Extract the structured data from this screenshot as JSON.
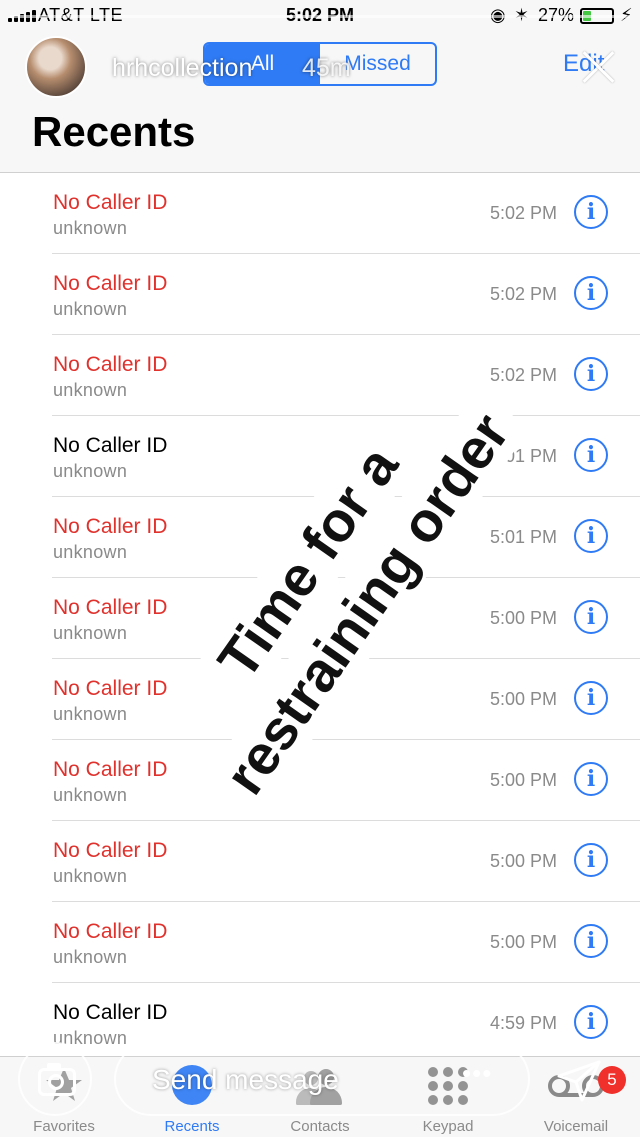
{
  "status_bar": {
    "carrier": "AT&T  LTE",
    "time": "5:02 PM",
    "battery_percent": "27%",
    "battery_level": 0.27,
    "icons": [
      "signal-bars-icon",
      "location-icon",
      "bluetooth-icon",
      "battery-icon",
      "charging-icon"
    ]
  },
  "header": {
    "segments": [
      "All",
      "Missed"
    ],
    "selected_segment": "All",
    "edit_label": "Edit",
    "title": "Recents"
  },
  "story": {
    "username": "hrhcollection",
    "age": "45m",
    "sticker_text": [
      "Time for a",
      "restraining order"
    ],
    "message_placeholder": "Send message",
    "more_glyph": "•••"
  },
  "calls": [
    {
      "name": "No Caller ID",
      "detail": "unknown",
      "time": "5:02 PM",
      "missed": true
    },
    {
      "name": "No Caller ID",
      "detail": "unknown",
      "time": "5:02 PM",
      "missed": true
    },
    {
      "name": "No Caller ID",
      "detail": "unknown",
      "time": "5:02 PM",
      "missed": true
    },
    {
      "name": "No Caller ID",
      "detail": "unknown",
      "time": "5:01 PM",
      "missed": false
    },
    {
      "name": "No Caller ID",
      "detail": "unknown",
      "time": "5:01 PM",
      "missed": true
    },
    {
      "name": "No Caller ID",
      "detail": "unknown",
      "time": "5:00 PM",
      "missed": true
    },
    {
      "name": "No Caller ID",
      "detail": "unknown",
      "time": "5:00 PM",
      "missed": true
    },
    {
      "name": "No Caller ID",
      "detail": "unknown",
      "time": "5:00 PM",
      "missed": true
    },
    {
      "name": "No Caller ID",
      "detail": "unknown",
      "time": "5:00 PM",
      "missed": true
    },
    {
      "name": "No Caller ID",
      "detail": "unknown",
      "time": "5:00 PM",
      "missed": true
    },
    {
      "name": "No Caller ID",
      "detail": "unknown",
      "time": "4:59 PM",
      "missed": false
    }
  ],
  "info_glyph": "i",
  "tab_bar": {
    "tabs": [
      {
        "label": "Favorites",
        "icon": "star-icon"
      },
      {
        "label": "Recents",
        "icon": "clock-icon"
      },
      {
        "label": "Contacts",
        "icon": "contacts-icon"
      },
      {
        "label": "Keypad",
        "icon": "keypad-icon"
      },
      {
        "label": "Voicemail",
        "icon": "voicemail-icon"
      }
    ],
    "active_tab": "Recents",
    "voicemail_badge": "5"
  },
  "colors": {
    "accent": "#2f7bf5",
    "missed": "#e0312c",
    "secondary_text": "#8a8a8a",
    "badge": "#f0302a",
    "battery": "#44c844"
  }
}
